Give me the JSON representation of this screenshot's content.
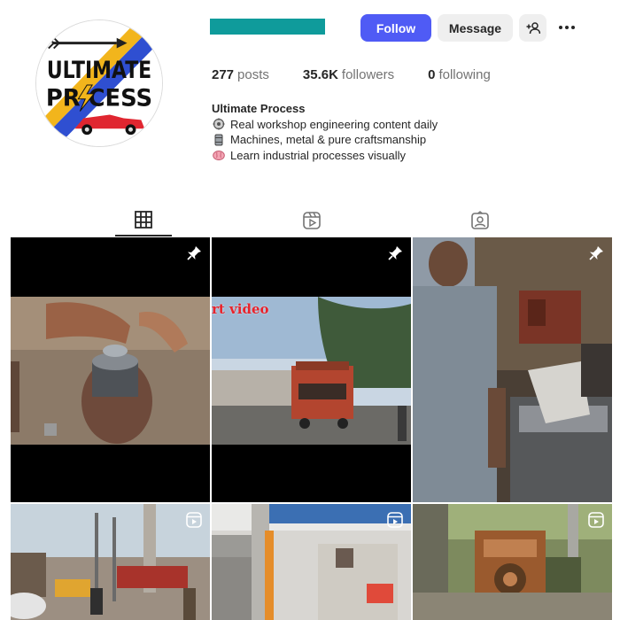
{
  "profile": {
    "display_name": "Ultimate Process",
    "avatar_text_top": "ULTIMATE",
    "avatar_text_bottom": "PR CESS",
    "name_bar_color": "#0f9b9b"
  },
  "actions": {
    "follow_label": "Follow",
    "message_label": "Message",
    "follow_color": "#4f5bf5"
  },
  "stats": {
    "posts_count": "277",
    "posts_label": "posts",
    "followers_count": "35.6K",
    "followers_label": "followers",
    "following_count": "0",
    "following_label": "following"
  },
  "bio": {
    "name": "Ultimate Process",
    "lines": [
      {
        "icon": "gear-icon",
        "text": "Real workshop engineering content daily"
      },
      {
        "icon": "barrel-icon",
        "text": "Machines, metal & pure craftsmanship"
      },
      {
        "icon": "brain-icon",
        "text": "Learn industrial processes visually"
      }
    ]
  },
  "tabs": [
    {
      "name": "posts",
      "icon": "grid-icon",
      "active": true
    },
    {
      "name": "reels",
      "icon": "reels-icon",
      "active": false
    },
    {
      "name": "tagged",
      "icon": "tagged-icon",
      "active": false
    }
  ],
  "posts": [
    {
      "badge": "pin-icon",
      "overlay_text": ""
    },
    {
      "badge": "pin-icon",
      "overlay_text": "rt video"
    },
    {
      "badge": "pin-icon",
      "overlay_text": ""
    },
    {
      "badge": "reel-icon",
      "overlay_text": ""
    },
    {
      "badge": "reel-icon",
      "overlay_text": ""
    },
    {
      "badge": "reel-icon",
      "overlay_text": ""
    }
  ]
}
